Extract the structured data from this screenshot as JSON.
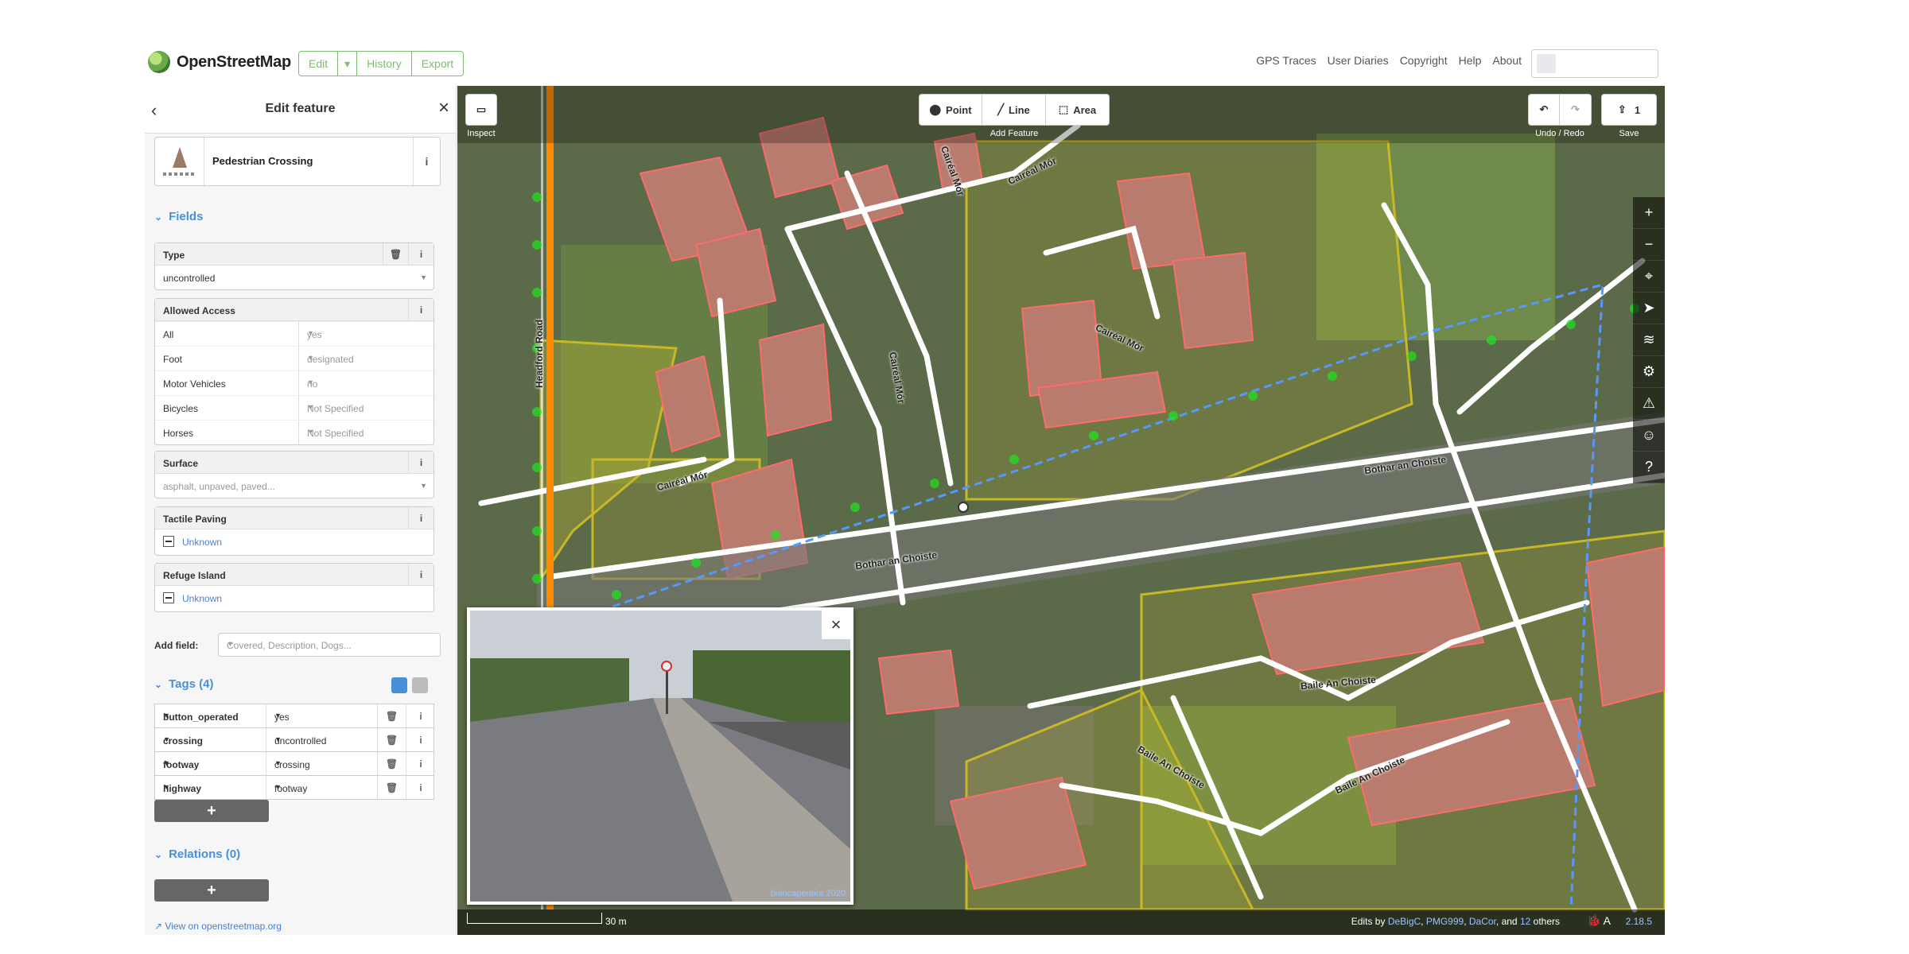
{
  "header": {
    "brand": "OpenStreetMap",
    "buttons": [
      "Edit",
      "History",
      "Export"
    ],
    "links": [
      "GPS Traces",
      "User Diaries",
      "Copyright",
      "Help",
      "About"
    ]
  },
  "sidebar": {
    "title": "Edit feature",
    "preset": "Pedestrian Crossing",
    "fields_heading": "Fields",
    "type_field": {
      "label": "Type",
      "value": "uncontrolled"
    },
    "access_field": {
      "label": "Allowed Access",
      "rows": [
        {
          "key": "All",
          "value": "yes"
        },
        {
          "key": "Foot",
          "value": "designated"
        },
        {
          "key": "Motor Vehicles",
          "value": "no"
        },
        {
          "key": "Bicycles",
          "value": "Not Specified"
        },
        {
          "key": "Horses",
          "value": "Not Specified"
        }
      ]
    },
    "surface_field": {
      "label": "Surface",
      "placeholder": "asphalt, unpaved, paved..."
    },
    "tactile_field": {
      "label": "Tactile Paving",
      "value": "Unknown"
    },
    "refuge_field": {
      "label": "Refuge Island",
      "value": "Unknown"
    },
    "add_field": {
      "label": "Add field:",
      "placeholder": "Covered, Description, Dogs..."
    },
    "tags_heading": "Tags (4)",
    "tags": [
      {
        "key": "button_operated",
        "value": "yes"
      },
      {
        "key": "crossing",
        "value": "uncontrolled"
      },
      {
        "key": "footway",
        "value": "crossing"
      },
      {
        "key": "highway",
        "value": "footway"
      }
    ],
    "add_symbol": "+",
    "relations_heading": "Relations (0)",
    "view_link": "View on openstreetmap.org"
  },
  "map": {
    "inspect_label": "Inspect",
    "add_feature_label": "Add Feature",
    "tools": [
      "Point",
      "Line",
      "Area"
    ],
    "undo_redo_label": "Undo / Redo",
    "save_label": "Save",
    "save_count": "1",
    "road_labels": [
      "Headford Road",
      "Cairéal Mór",
      "Cairéal Mór",
      "Cairéal Mór",
      "Cairéal Mór",
      "Cairéal Mór",
      "Bothar an Choiste",
      "Bothar an Choiste",
      "Baile An Choiste",
      "Baile An Choiste",
      "Baile An Choiste"
    ],
    "scale": "30 m",
    "edits_prefix": "Edits by",
    "editors": [
      "DeBigC",
      "PMG999",
      "DaCor"
    ],
    "edits_and": "and",
    "others_count": "12",
    "others_suffix": "others",
    "version": "2.18.5",
    "photo_credit": "biancapereira 2020"
  },
  "colors": {
    "brand_green": "#7ebc6f",
    "link_blue": "#4a7fd4",
    "gps_green": "#22dd22",
    "gpx_blue": "#5599ff"
  }
}
